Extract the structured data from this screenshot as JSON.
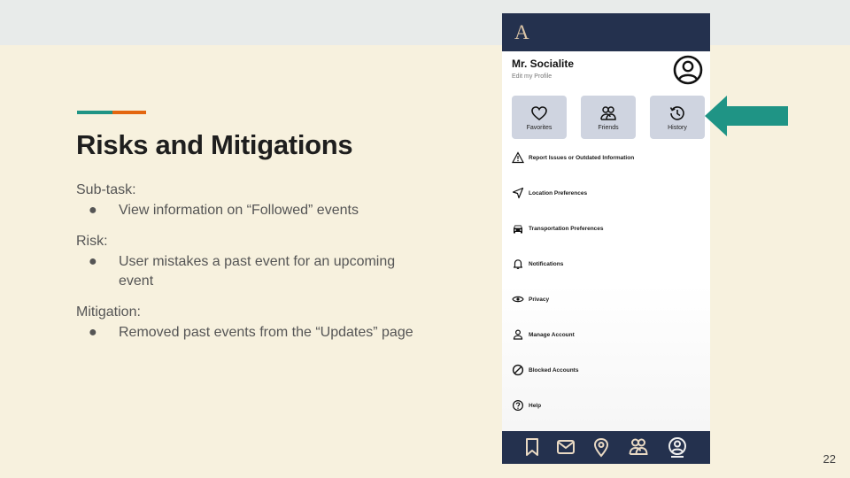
{
  "slide": {
    "title": "Risks and Mitigations",
    "sections": [
      {
        "label": "Sub-task:",
        "bullets": [
          "View information on “Followed” events"
        ]
      },
      {
        "label": "Risk:",
        "bullets": [
          "User mistakes a past event for an upcoming event"
        ]
      },
      {
        "label": "Mitigation:",
        "bullets": [
          "Removed past events from the “Updates” page"
        ]
      }
    ],
    "bullet_glyph": "●",
    "page_number": "22"
  },
  "phone": {
    "logo_letter": "A",
    "profile": {
      "name": "Mr. Socialite",
      "edit_link": "Edit my Profile",
      "icon": "user-circle-icon"
    },
    "quick_actions": [
      {
        "label": "Favorites",
        "icon": "heart-icon"
      },
      {
        "label": "Friends",
        "icon": "friends-icon"
      },
      {
        "label": "History",
        "icon": "history-icon"
      }
    ],
    "menu": [
      {
        "label": "Report Issues or Outdated Information",
        "icon": "warning-icon"
      },
      {
        "label": "Location Preferences",
        "icon": "location-arrow-icon"
      },
      {
        "label": "Transportation Preferences",
        "icon": "car-icon"
      },
      {
        "label": "Notifications",
        "icon": "bell-icon"
      },
      {
        "label": "Privacy",
        "icon": "eye-icon"
      },
      {
        "label": "Manage Account",
        "icon": "person-icon"
      },
      {
        "label": "Blocked Accounts",
        "icon": "block-icon"
      },
      {
        "label": "Help",
        "icon": "help-icon"
      }
    ],
    "tabs": [
      {
        "icon": "bookmark-icon",
        "active": false
      },
      {
        "icon": "mail-icon",
        "active": false
      },
      {
        "icon": "map-pin-icon",
        "active": false
      },
      {
        "icon": "friends-icon",
        "active": false
      },
      {
        "icon": "profile-icon",
        "active": true
      }
    ]
  },
  "colors": {
    "slide_background": "#f7f1de",
    "header_band": "#e8ebea",
    "accent_teal": "#1f9485",
    "accent_orange": "#e3660f",
    "phone_navy": "#24314e",
    "logo_gold": "#d9c3a6",
    "quick_button_bg": "#cfd4e0",
    "tab_icon": "#e9d9c3",
    "callout_arrow": "#1f9485"
  }
}
